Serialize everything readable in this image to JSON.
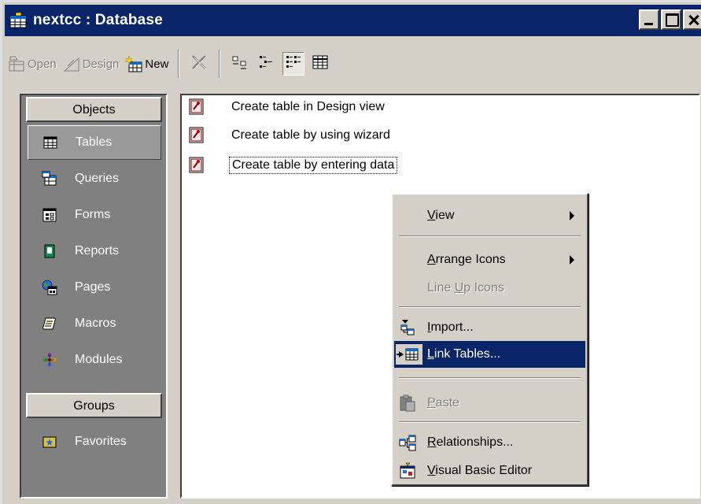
{
  "window": {
    "title": "nextcc : Database",
    "icon": "database-icon"
  },
  "toolbar": {
    "open_label": "Open",
    "design_label": "Design",
    "new_label": "New"
  },
  "nav": {
    "objects_header": "Objects",
    "groups_header": "Groups",
    "items": [
      {
        "label": "Tables",
        "icon": "table-icon",
        "selected": true
      },
      {
        "label": "Queries",
        "icon": "query-icon"
      },
      {
        "label": "Forms",
        "icon": "form-icon"
      },
      {
        "label": "Reports",
        "icon": "report-icon"
      },
      {
        "label": "Pages",
        "icon": "page-icon"
      },
      {
        "label": "Macros",
        "icon": "macro-icon"
      },
      {
        "label": "Modules",
        "icon": "module-icon"
      }
    ],
    "groups": [
      {
        "label": "Favorites",
        "icon": "favorites-folder-icon"
      }
    ]
  },
  "list": {
    "items": [
      {
        "label": "Create table in Design view",
        "icon": "shortcut-wand-icon"
      },
      {
        "label": "Create table by using wizard",
        "icon": "shortcut-wand-icon"
      },
      {
        "label": "Create table by entering data",
        "icon": "shortcut-wand-icon",
        "focused": true
      }
    ]
  },
  "context_menu": {
    "view": {
      "pre": "",
      "key": "V",
      "post": "iew"
    },
    "arrange_icons": {
      "pre": "",
      "key": "A",
      "post": "rrange Icons"
    },
    "line_up_icons": {
      "pre": "Line ",
      "key": "U",
      "post": "p Icons"
    },
    "import": {
      "pre": "",
      "key": "I",
      "post": "mport..."
    },
    "link_tables": {
      "pre": "",
      "key": "L",
      "post": "ink Tables..."
    },
    "paste": {
      "pre": "",
      "key": "P",
      "post": "aste"
    },
    "relationships": {
      "pre": "",
      "key": "R",
      "post": "elationships..."
    },
    "vbe": {
      "pre": "",
      "key": "V",
      "post": "isual Basic Editor"
    }
  },
  "colors": {
    "title_bar": "#0a246a",
    "face": "#d4d0c8",
    "nav_bg": "#808080",
    "highlight": "#0a246a"
  }
}
